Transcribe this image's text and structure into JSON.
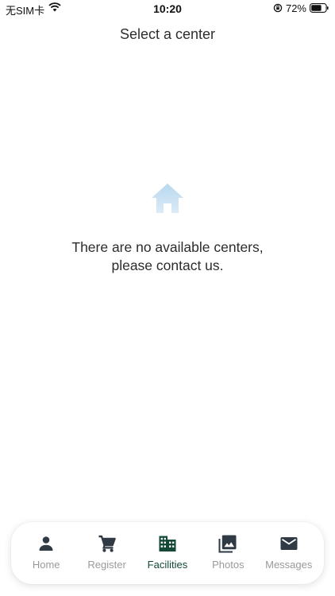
{
  "status_bar": {
    "carrier": "无SIM卡",
    "time": "10:20",
    "battery_percent": "72%",
    "battery_level": 0.72,
    "icons": [
      "wifi-icon",
      "orientation-lock-icon",
      "battery-icon"
    ]
  },
  "header": {
    "title": "Select a center"
  },
  "empty_state": {
    "icon": "home-icon",
    "line1": "There are no available centers,",
    "line2": "please contact us."
  },
  "tab_bar": {
    "items": [
      {
        "label": "Home",
        "icon": "person-icon",
        "active": false
      },
      {
        "label": "Register",
        "icon": "cart-icon",
        "active": false
      },
      {
        "label": "Facilities",
        "icon": "building-icon",
        "active": true
      },
      {
        "label": "Photos",
        "icon": "photos-icon",
        "active": false
      },
      {
        "label": "Messages",
        "icon": "mail-icon",
        "active": false
      }
    ]
  },
  "colors": {
    "active_tab": "#134936",
    "inactive_icon": "#2f3a44",
    "inactive_label": "#9a9a9a",
    "empty_icon": "#cfe3f3"
  }
}
